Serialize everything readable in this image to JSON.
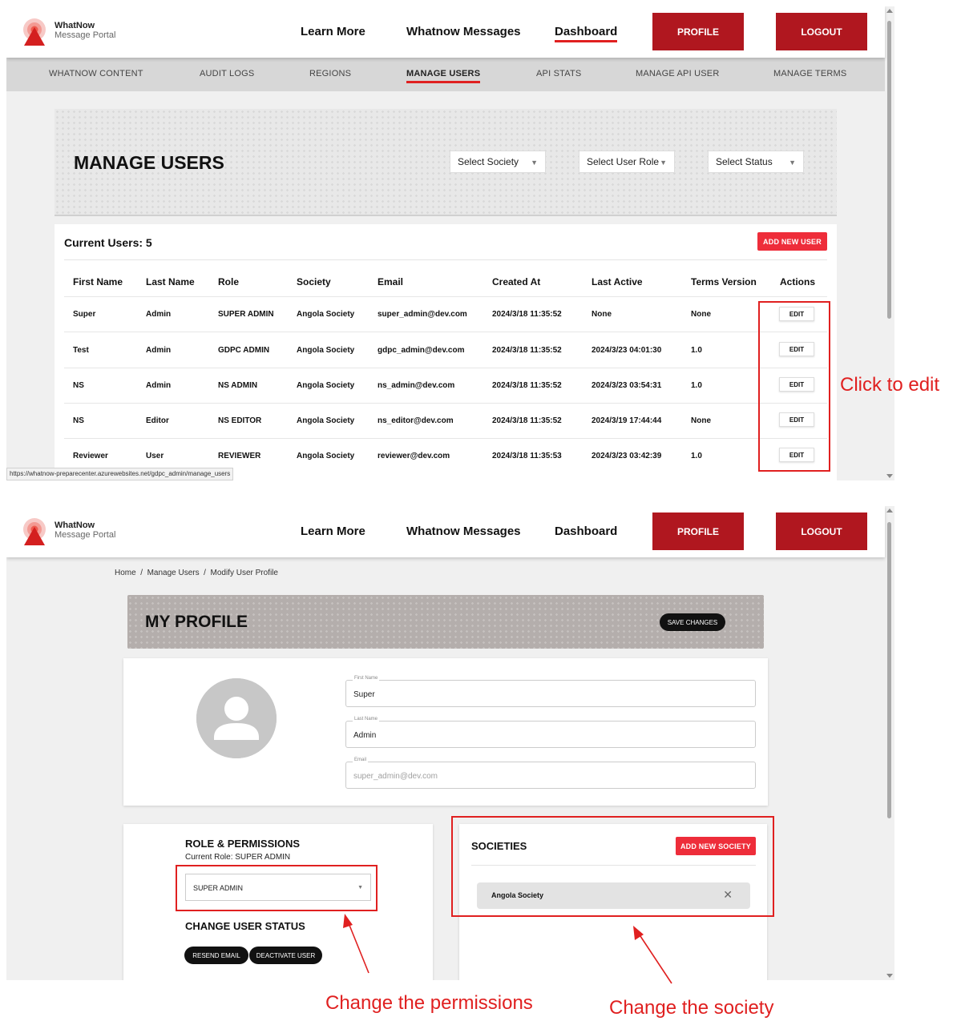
{
  "brand": {
    "title": "WhatNow",
    "subtitle": "Message Portal"
  },
  "nav": {
    "learn_more": "Learn More",
    "whatnow_messages": "Whatnow Messages",
    "dashboard": "Dashboard",
    "profile": "PROFILE",
    "logout": "LOGOUT"
  },
  "subnav": {
    "items": [
      "WHATNOW CONTENT",
      "AUDIT LOGS",
      "REGIONS",
      "MANAGE USERS",
      "API STATS",
      "MANAGE API USER",
      "MANAGE TERMS"
    ],
    "active": "MANAGE USERS"
  },
  "manage_users": {
    "title": "MANAGE USERS",
    "filters": {
      "society": "Select Society",
      "role": "Select User Role",
      "status": "Select Status"
    },
    "current_users": "Current Users: 5",
    "add_new_user": "ADD NEW USER",
    "columns": [
      "First Name",
      "Last Name",
      "Role",
      "Society",
      "Email",
      "Created At",
      "Last Active",
      "Terms Version",
      "Actions"
    ],
    "rows": [
      [
        "Super",
        "Admin",
        "SUPER ADMIN",
        "Angola Society",
        "super_admin@dev.com",
        "2024/3/18 11:35:52",
        "None",
        "None",
        "EDIT"
      ],
      [
        "Test",
        "Admin",
        "GDPC ADMIN",
        "Angola Society",
        "gdpc_admin@dev.com",
        "2024/3/18 11:35:52",
        "2024/3/23 04:01:30",
        "1.0",
        "EDIT"
      ],
      [
        "NS",
        "Admin",
        "NS ADMIN",
        "Angola Society",
        "ns_admin@dev.com",
        "2024/3/18 11:35:52",
        "2024/3/23 03:54:31",
        "1.0",
        "EDIT"
      ],
      [
        "NS",
        "Editor",
        "NS EDITOR",
        "Angola Society",
        "ns_editor@dev.com",
        "2024/3/18 11:35:52",
        "2024/3/19 17:44:44",
        "None",
        "EDIT"
      ],
      [
        "Reviewer",
        "User",
        "REVIEWER",
        "Angola Society",
        "reviewer@dev.com",
        "2024/3/18 11:35:53",
        "2024/3/23 03:42:39",
        "1.0",
        "EDIT"
      ]
    ],
    "status_url": "https://whatnow-preparecenter.azurewebsites.net/gdpc_admin/manage_users"
  },
  "profile_page": {
    "breadcrumb": "Home  /  Manage Users  /  Modify User Profile",
    "title": "MY PROFILE",
    "save_changes": "SAVE CHANGES",
    "first_name_label": "First Name",
    "first_name": "Super",
    "last_name_label": "Last Name",
    "last_name": "Admin",
    "email_label": "Email",
    "email": "super_admin@dev.com",
    "role_title": "ROLE & PERMISSIONS",
    "current_role": "Current Role: SUPER ADMIN",
    "role_value": "SUPER ADMIN",
    "status_title": "CHANGE USER STATUS",
    "resend_email": "RESEND EMAIL",
    "deactivate_user": "DEACTIVATE USER",
    "societies_title": "SOCIETIES",
    "add_new_society": "ADD NEW SOCIETY",
    "society_chip": "Angola Society"
  },
  "annotations": {
    "click_to_edit": "Click to edit",
    "change_permissions": "Change the permissions",
    "change_society": "Change the society"
  },
  "colors": {
    "brand_red": "#b0171f",
    "accent_red": "#ee2d3a",
    "annotation_red": "#e02020"
  }
}
